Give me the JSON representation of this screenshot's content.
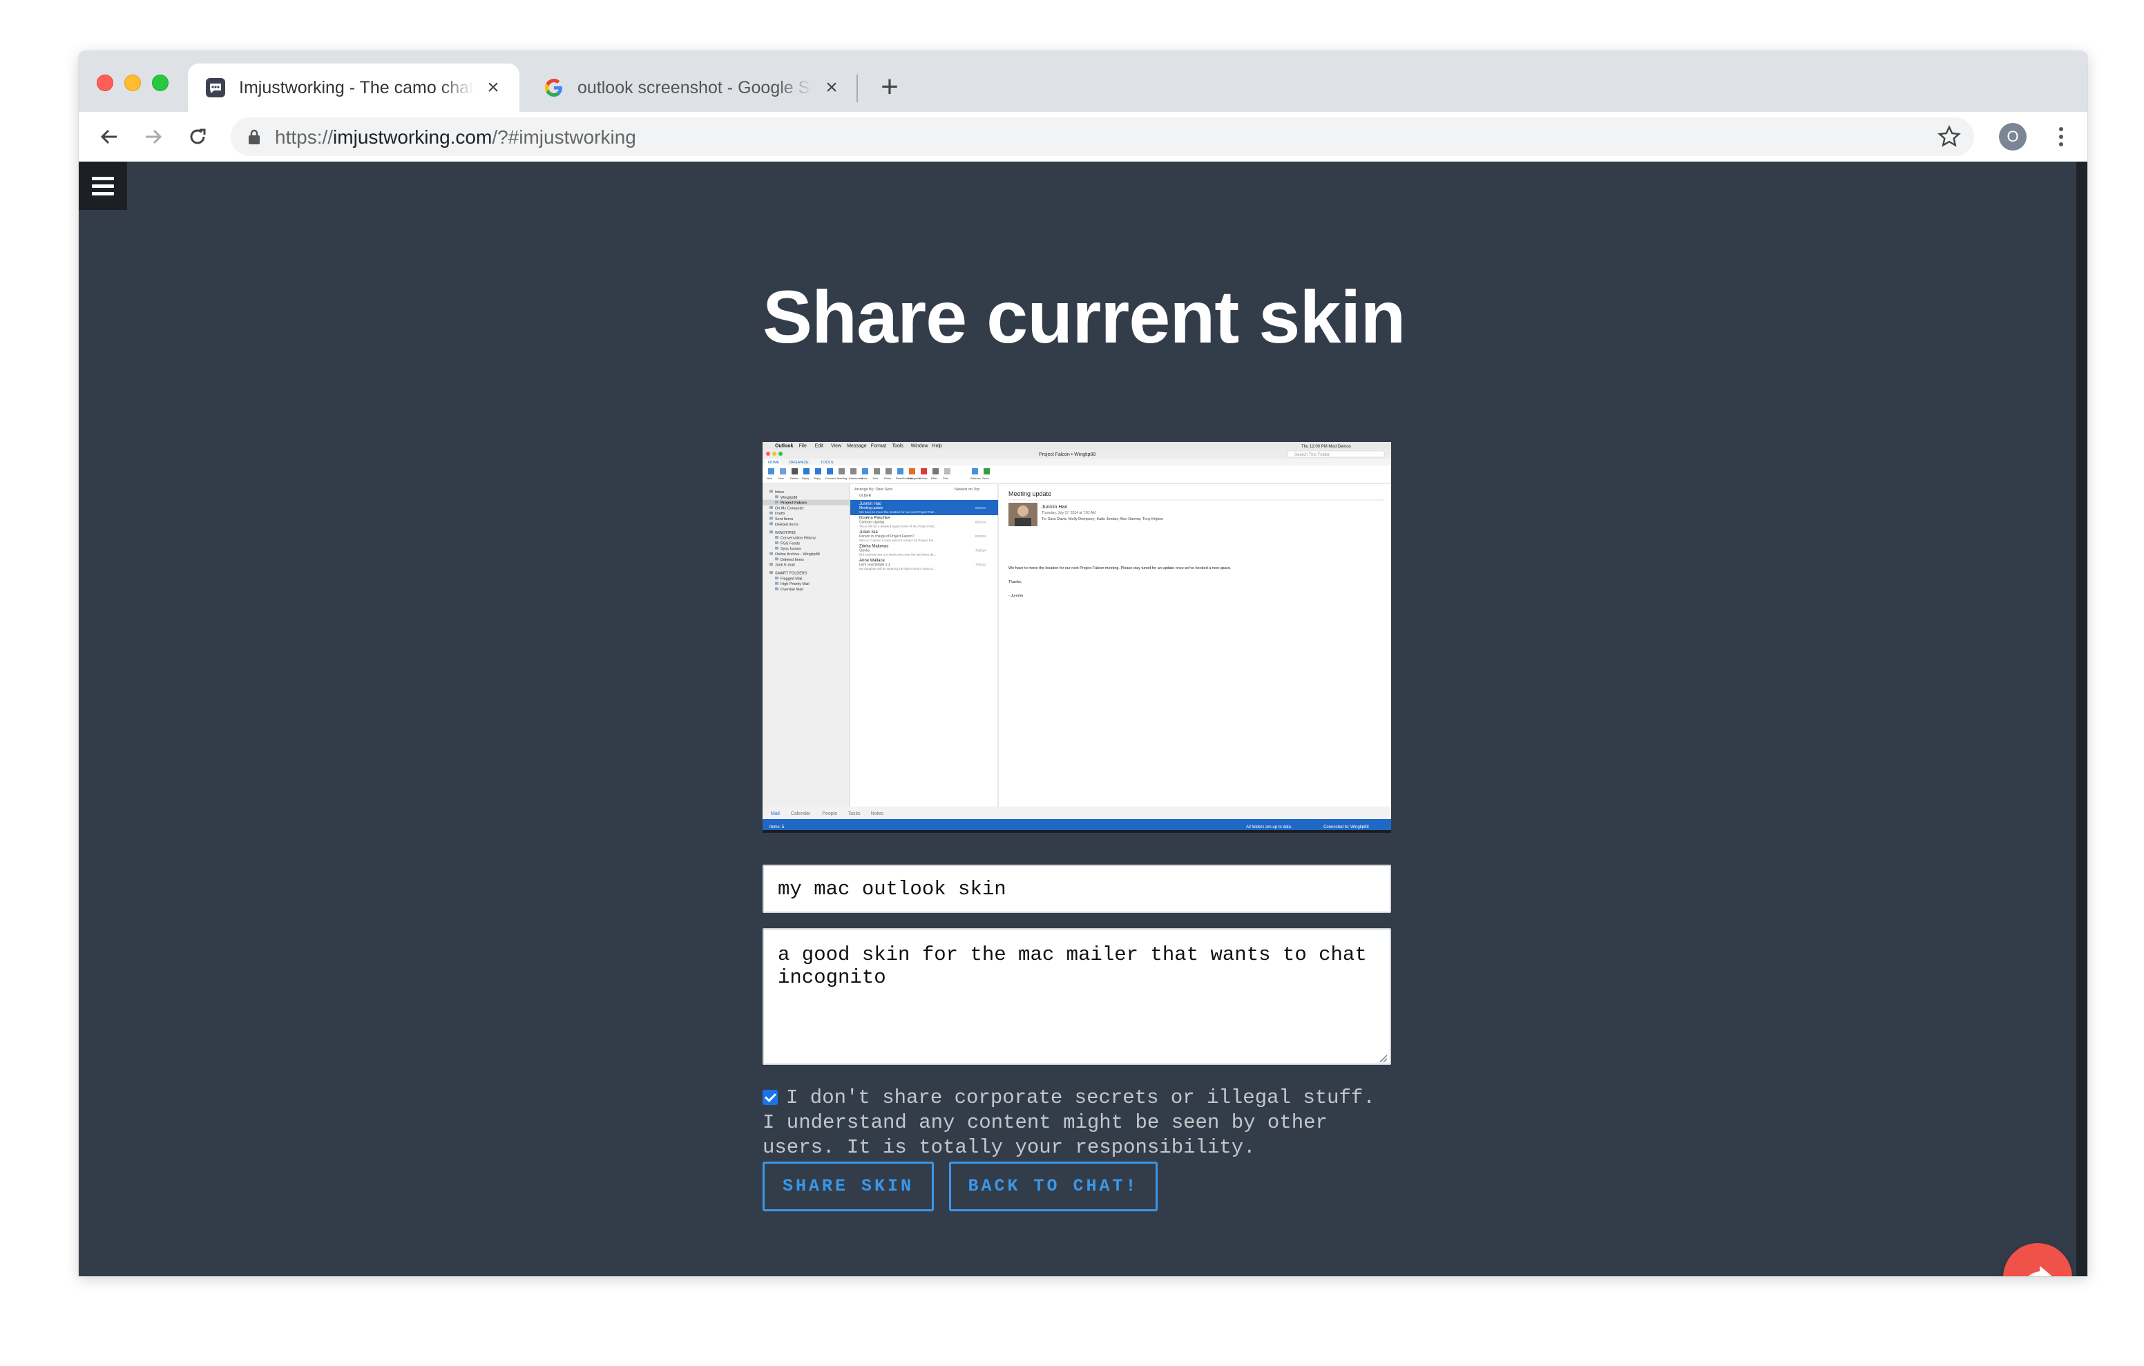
{
  "browser": {
    "tabs": [
      {
        "title": "Imjustworking - The camo chat",
        "favicon": "chat-bubble-icon",
        "active": true
      },
      {
        "title": "outlook screenshot - Google Search",
        "favicon": "google-g-icon",
        "active": false
      }
    ],
    "url_scheme": "https://",
    "url_host": "imjustworking.com",
    "url_rest": "/?#imjustworking",
    "profile_initial": "O"
  },
  "page": {
    "heading": "Share current skin",
    "skin_name_value": "my mac outlook skin",
    "skin_description_value": "a good skin for the mac mailer that wants to chat incognito",
    "consent_checked": true,
    "consent_text": "I don't share corporate secrets or illegal stuff. I understand any content might be seen by other users. It is totally your responsibility.",
    "share_button": "SHARE SKIN",
    "back_button": "BACK TO CHAT!",
    "fab_icon": "share-arrow-icon"
  },
  "preview": {
    "menubar": [
      "Outlook",
      "File",
      "Edit",
      "View",
      "Message",
      "Format",
      "Tools",
      "Window",
      "Help"
    ],
    "menubar_right": "Thu 12:00 PM   Mod Demos",
    "window_title": "Project Falcon • Wingtip88",
    "search_placeholder": "Search This Folder",
    "ribbon_tabs": [
      "HOME",
      "ORGANIZE",
      "TOOLS"
    ],
    "ribbon_buttons": [
      "New Email",
      "New Items",
      "Delete",
      "Reply",
      "Reply All",
      "Forward",
      "Meeting",
      "Attachment",
      "Move",
      "Junk",
      "Rules",
      "Read/Unread",
      "Categorize",
      "Follow Up",
      "Filter Email",
      "Find a Contact",
      "Address Book",
      "Send & Receive"
    ],
    "folders": [
      "Inbox",
      "Wingtip88",
      "Project Falcon",
      "On My Computer",
      "Drafts",
      "Sent Items",
      "Deleted Items",
      "WINGTIP88",
      "Conversation History",
      "RSS Feeds",
      "Sync Issues",
      "Online Archive - Wingtip88",
      "Deleted Items",
      "Junk E-mail",
      "SMART FOLDERS",
      "Flagged Mail",
      "High Priority Mail",
      "Overdue Mail"
    ],
    "arrange_label": "Arrange By: Date Sent",
    "sort_label": "Newest on Top",
    "older_label": "OLDER",
    "messages": [
      {
        "sender": "Junmin Hao",
        "subject": "Meeting update",
        "preview": "We have to move the location for our next Project Falc...",
        "date": "8/10/14"
      },
      {
        "sender": "Dorena Paschke",
        "subject": "Contract signing",
        "preview": "There will be a detailed legal review of the Project Falc...",
        "date": "8/10/14"
      },
      {
        "sender": "Julian Isla",
        "subject": "Person in charge of Project Falcon?",
        "preview": "Who is Contoso's main point of contact for Project Fal...",
        "date": "8/10/14"
      },
      {
        "sender": "Zrinka Makovac",
        "subject": "Stocks",
        "preview": "Did anybody see our stock price over the last three da...",
        "date": "7/18/14"
      },
      {
        "sender": "Anne Wallace",
        "subject": "Let's reschedule 1:1",
        "preview": "My daughter will be wearing the high school's mascot...",
        "date": "7/18/14"
      }
    ],
    "reading_subject": "Meeting update",
    "reading_from": "Junmin Hao",
    "reading_date": "Thursday, July 17, 2014 at 7:01 AM",
    "reading_to": "To:  Sara Davis;  Molly Dempsey;  Katie Jordan;  Alex Darrow;  Tony Krijnen",
    "reading_body": "We have to move the location for our next Project Falcon meeting.  Please stay tuned for an update once we've booked a new space.",
    "reading_thanks": "Thanks,",
    "reading_sig": "- Junmin",
    "nav_items": [
      "Mail",
      "Calendar",
      "People",
      "Tasks",
      "Notes"
    ],
    "status_left": "Items: 5",
    "status_mid": "All folders are up to date.",
    "status_right": "Connected to: Wingtip88"
  }
}
